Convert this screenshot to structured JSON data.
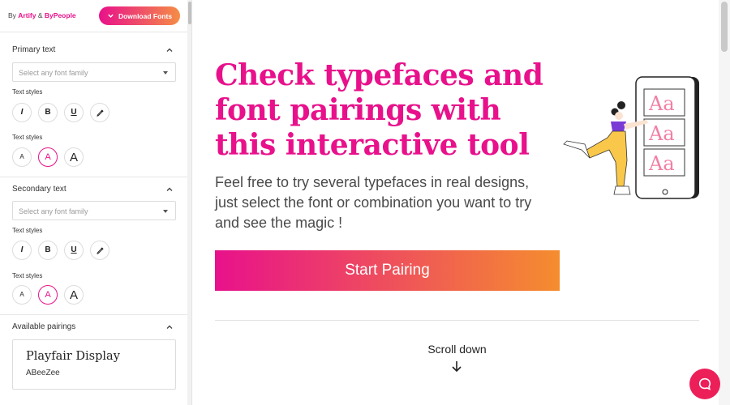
{
  "topbar": {
    "by_prefix": "By",
    "brand_one": "Artify",
    "amp": "&",
    "brand_two": "ByPeople",
    "download_label": "Download Fonts"
  },
  "primary": {
    "title": "Primary text",
    "select_placeholder": "Select any font family",
    "styles_label_1": "Text styles",
    "styles_label_2": "Text styles",
    "style_buttons": [
      "I",
      "B",
      "U"
    ],
    "size_buttons": [
      "A",
      "A",
      "A"
    ]
  },
  "secondary": {
    "title": "Secondary text",
    "select_placeholder": "Select any font family",
    "styles_label_1": "Text styles",
    "styles_label_2": "Text styles",
    "style_buttons": [
      "I",
      "B",
      "U"
    ],
    "size_buttons": [
      "A",
      "A",
      "A"
    ]
  },
  "pairings": {
    "title": "Available pairings",
    "items": [
      {
        "heading_font": "Playfair Display",
        "body_font": "ABeeZee"
      }
    ]
  },
  "hero": {
    "headline": "Check typefaces and font pairings with this interactive tool",
    "subtext": "Feel free to try several typefaces in real designs, just select the font or combination you want to try and see the magic !",
    "cta_label": "Start Pairing",
    "scroll_label": "Scroll down"
  },
  "illustration": {
    "tiles": [
      "Aa",
      "Aa",
      "Aa"
    ]
  },
  "colors": {
    "accent": "#e8118b",
    "accent_end": "#f58d2e",
    "chat": "#ec1f59"
  },
  "icons": {
    "download": "chevron-down-icon",
    "collapse": "chevron-up-icon",
    "color_picker": "eyedropper-icon",
    "scroll": "arrow-down-icon",
    "chat": "chat-bubble-icon"
  }
}
